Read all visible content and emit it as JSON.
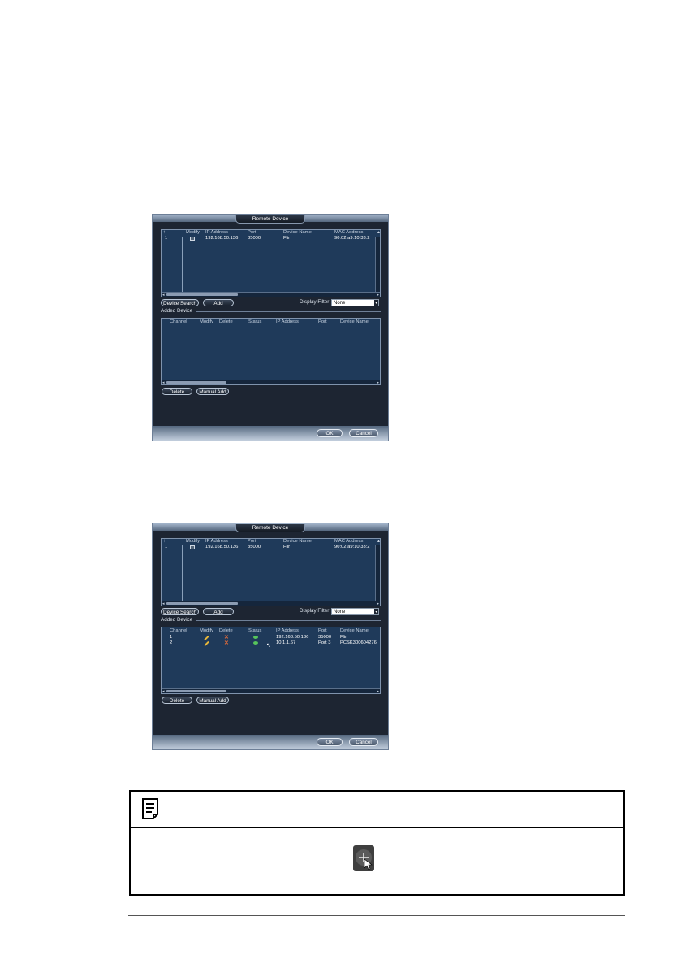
{
  "screens": [
    {
      "title": "Remote Device",
      "search_headers": [
        "↑",
        "Modify",
        "IP Address",
        "Port",
        "Device Name",
        "MAC Address"
      ],
      "search_rows": [
        {
          "index": "1",
          "ip": "192.168.50.136",
          "port": "35000",
          "name": "Flir",
          "mac": "90:02:a9:10:33:2"
        }
      ],
      "buttons": {
        "device_search": "Device Search",
        "add": "Add",
        "delete": "Delete",
        "manual_add": "Manual Add",
        "ok": "OK",
        "cancel": "Cancel"
      },
      "display_filter_label": "Display Filter",
      "display_filter_value": "None",
      "added_label": "Added Device",
      "added_headers": [
        "Channel",
        "Modify",
        "Delete",
        "Status",
        "IP Address",
        "Port",
        "Device Name"
      ],
      "added_rows": []
    },
    {
      "title": "Remote Device",
      "search_headers": [
        "↑",
        "Modify",
        "IP Address",
        "Port",
        "Device Name",
        "MAC Address"
      ],
      "search_rows": [
        {
          "index": "1",
          "ip": "192.168.50.136",
          "port": "35000",
          "name": "Flir",
          "mac": "90:02:a9:10:33:2"
        }
      ],
      "buttons": {
        "device_search": "Device Search",
        "add": "Add",
        "delete": "Delete",
        "manual_add": "Manual Add",
        "ok": "OK",
        "cancel": "Cancel"
      },
      "display_filter_label": "Display Filter",
      "display_filter_value": "None",
      "added_label": "Added Device",
      "added_headers": [
        "Channel",
        "Modify",
        "Delete",
        "Status",
        "IP Address",
        "Port",
        "Device Name"
      ],
      "added_rows": [
        {
          "channel": "1",
          "ip": "192.168.50.136",
          "port": "35000",
          "name": "Flir"
        },
        {
          "channel": "2",
          "ip": "10.1.1.67",
          "port": "Port 3",
          "name": "PCSK300604276"
        }
      ]
    }
  ],
  "icons": {
    "note": "note-icon",
    "plus": "plus-cursor-icon",
    "modify": "modify-icon",
    "edit": "pencil-icon",
    "delete": "x-icon",
    "status": "status-dot-icon"
  },
  "colors": {
    "window_bg": "#1d2532",
    "table_bg": "#1f3a5a",
    "status_ok": "#57c45b",
    "delete_x": "#e06b3a",
    "edit_pencil": "#e8b73a"
  }
}
